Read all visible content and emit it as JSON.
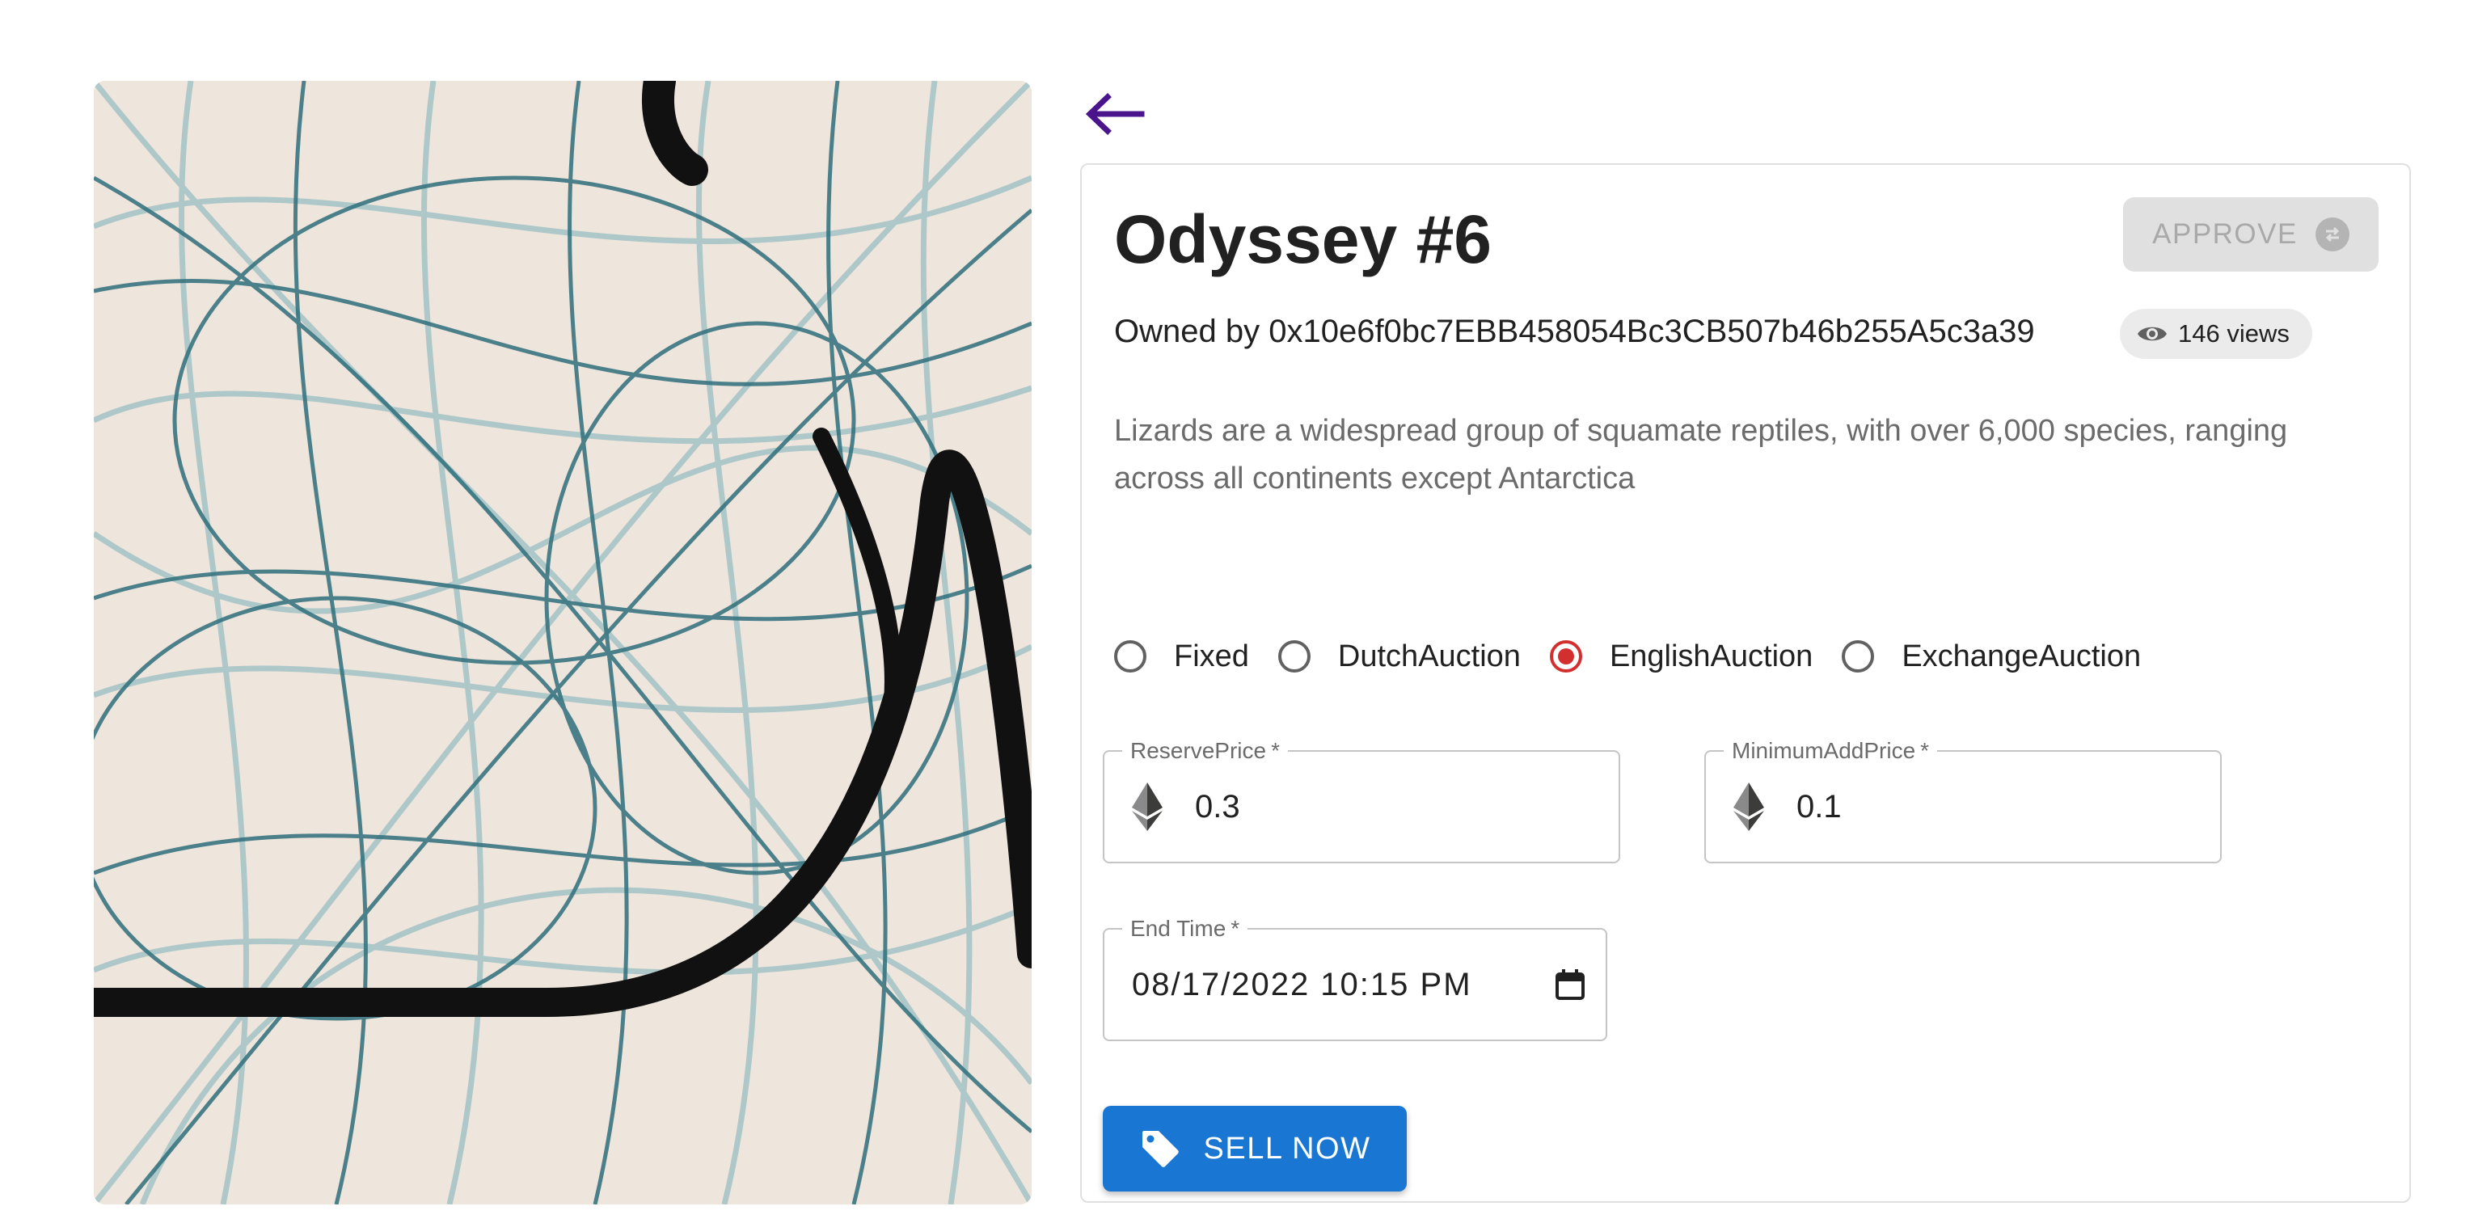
{
  "nft": {
    "title": "Odyssey #6",
    "owner_text": "Owned by 0x10e6f0bc7EBB458054Bc3CB507b46b255A5c3a39",
    "views_text": "146 views",
    "description": "Lizards are a widespread group of squamate reptiles, with over 6,000 species, ranging across all continents except Antarctica"
  },
  "actions": {
    "approve_label": "APPROVE",
    "sell_label": "SELL NOW"
  },
  "sale_types": {
    "options": [
      "Fixed",
      "DutchAuction",
      "EnglishAuction",
      "ExchangeAuction"
    ],
    "selected": "EnglishAuction"
  },
  "form": {
    "reserve_price": {
      "label": "ReservePrice",
      "required_mark": "*",
      "value": "0.3"
    },
    "minimum_add_price": {
      "label": "MinimumAddPrice",
      "required_mark": "*",
      "value": "0.1"
    },
    "end_time": {
      "label": "End Time",
      "required_mark": "*",
      "value": "08/17/2022 10:15 PM"
    }
  },
  "icons": {
    "back": "arrow-left-icon",
    "approve": "swap-icon",
    "views": "eye-icon",
    "currency": "ethereum-icon",
    "calendar": "calendar-icon",
    "sell": "tag-icon"
  },
  "colors": {
    "primary": "#1976d2",
    "back_arrow": "#4a148c",
    "radio_selected": "#d32f2f",
    "artwork_background": "#eee5dc",
    "artwork_lines": "#2f6f7c"
  }
}
